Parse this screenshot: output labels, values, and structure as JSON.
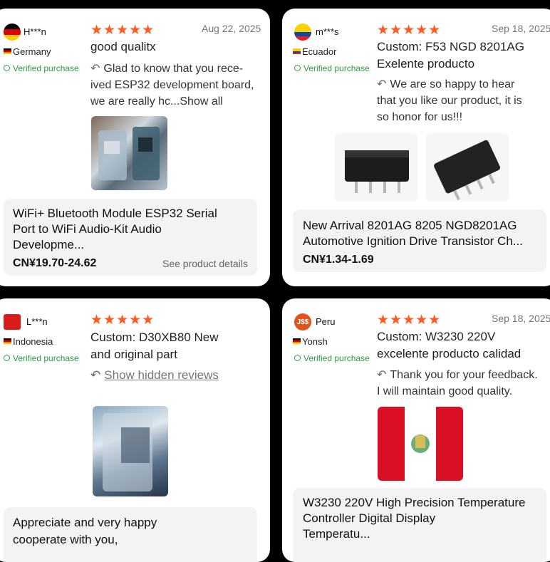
{
  "reviews": [
    {
      "user": "H***n",
      "country": "Germany",
      "verified": "Verified purchase",
      "stars": "★★★★★",
      "date": "Aug 22, 2025",
      "text_lines": [
        "good qualitx"
      ],
      "reply_lines": [
        "Glad to know that you rece-",
        "ived ESP32 development board,",
        "we are really hc...Show all"
      ],
      "product_title_lines": [
        "WiFi+ Bluetooth Module ESP32 Serial",
        "Port to WiFi Audio-Kit Audio",
        "Developme..."
      ],
      "price": "CN¥19.70-24.62",
      "see_details": "See product details"
    },
    {
      "user": "m***s",
      "country": "Ecuador",
      "verified": "Verified purchase",
      "stars": "★★★★★",
      "date": "Sep 18, 2025",
      "text_lines": [
        "Custom: F53 NGD 8201AG",
        "Exelente producto"
      ],
      "reply_lines": [
        "We are so happy to hear",
        "that you like our product, it is",
        "so honor for us!!!"
      ],
      "product_title_lines": [
        "New Arrival 8201AG 8205 NGD8201AG",
        "Automotive Ignition Drive Transistor Ch..."
      ],
      "price": "CN¥1.34-1.69"
    },
    {
      "user": "L***n",
      "country": "Indonesia",
      "verified": "Verified purchase",
      "stars": "★★★★★",
      "text_lines": [
        "Custom: D30XB80 New",
        "and original part"
      ],
      "hidden_link": "Show hidden reviews",
      "product_title_lines": [
        "Appreciate and very happy",
        "cooperate with you,"
      ]
    },
    {
      "user_initials": "J$$",
      "user": "Peru",
      "country": "Yonsh",
      "verified": "Verified purchase",
      "stars": "★★★★★",
      "date": "Sep 18, 2025",
      "text_lines": [
        "Custom: W3230 220V",
        "excelente producto calidad"
      ],
      "reply_lines": [
        "Thank you for your feedback.",
        "I will maintain good quality."
      ],
      "product_title_lines": [
        "W3230 220V High Precision Temperature",
        "Controller Digital Display",
        "Temperatu..."
      ]
    }
  ],
  "icons": {
    "reply": "↶",
    "verified": "check-circle-icon"
  },
  "colors": {
    "star": "#ff5a1f",
    "verified": "#2a9d3e",
    "background": "#000000"
  }
}
